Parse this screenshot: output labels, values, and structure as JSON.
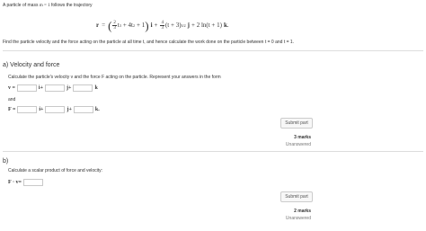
{
  "problem": {
    "intro_prefix": "A particle of mass ",
    "mass_expr": "m = 1",
    "intro_suffix": " follows the trajectory",
    "eq_r": "r",
    "eq_equals": "=",
    "eq_frac1_num": "2",
    "eq_frac1_den": "3",
    "eq_t3": "t",
    "eq_exp3": "3",
    "eq_plus4t2": "+ 4t",
    "eq_exp2": "2",
    "eq_plus1": "+ 1",
    "eq_i": "i",
    "eq_plus": "+",
    "eq_frac2_num": "4",
    "eq_frac2_den": "3",
    "eq_tplus3": "(t + 3)",
    "eq_exp32": "3/2",
    "eq_j": "j",
    "eq_plus2ln": "+ 2 ln(t + 1)",
    "eq_k": "k",
    "eq_end": ".",
    "description": "Find the particle velocity and the force acting on the particle at all time t, and hence calculate the work done on the particle between t = 0 and t = 1."
  },
  "part_a": {
    "title": "a) Velocity and force",
    "instruction": "Calculate the particle's velocity v and the force F acting on the particle. Represent your answers in the form",
    "v_label": "v =",
    "f_label": "F =",
    "and_label": "and",
    "i_label": "i+",
    "j_label": "j+",
    "k_label": "k",
    "k_label_end": "k.",
    "submit": "Submit part",
    "marks": "3 marks",
    "status": "Unanswered"
  },
  "part_b": {
    "title": "b)",
    "instruction": "Calculate a scalar product of force and velocity:",
    "label": "F · v=",
    "submit": "Submit part",
    "marks": "2 marks",
    "status": "Unanswered"
  }
}
